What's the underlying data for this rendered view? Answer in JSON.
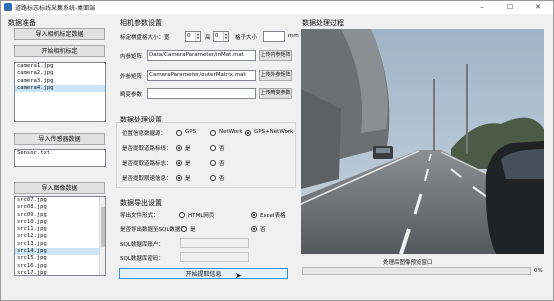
{
  "window": {
    "title": "道路标志标线采集系统-桌面端",
    "min_glyph": "–",
    "max_glyph": "☐",
    "close_glyph": "✕"
  },
  "left": {
    "data_prep_title": "数据准备",
    "import_calib_button": "导入相机标定数据",
    "start_calib_button": "开始相机标定",
    "camera_files": [
      "camera1.jpg",
      "camera2.jpg",
      "camera3.jpg",
      "camera4.jpg"
    ],
    "camera_selected_index": 3,
    "import_sensor_button": "导入传感器数据",
    "sensor_files": [
      "Sensor.txt"
    ],
    "import_image_button": "导入图像数据",
    "image_files": [
      "src07.jpg",
      "src08.jpg",
      "src09.jpg",
      "src10.jpg",
      "src11.jpg",
      "src12.jpg",
      "src13.jpg",
      "src14.jpg",
      "src15.jpg",
      "src16.jpg",
      "src17.jpg",
      "src18.jpg"
    ],
    "image_selected_index": 7
  },
  "camera": {
    "title": "相机参数设置",
    "board_size_label": "标定棋盘格大小：宽",
    "width_value": "0",
    "height_label": "高",
    "height_value": "0",
    "square_label": "格子大小",
    "square_value": "",
    "square_unit": "mm",
    "intrinsic_label": "内参矩阵",
    "intrinsic_value": "Data/CameraParameter/inMat.mat",
    "intrinsic_upload": "上传内参矩阵",
    "extrinsic_label": "外参矩阵",
    "extrinsic_value": "CameraParameter/outerMatrix.mat",
    "extrinsic_upload": "上传外参矩阵",
    "distortion_label": "畸变参数",
    "distortion_value": "",
    "distortion_upload": "上传畸变参数"
  },
  "processing": {
    "title": "数据处理设置",
    "location_source_label": "位置信息数据源：",
    "opt_gps": "GPS",
    "opt_network": "NetWork",
    "opt_gps_network": "GPS+NetWork",
    "location_choice": "gps_network",
    "extract_markings_label": "是否提取道路标线：",
    "extract_signs_label": "是否提取道路标志：",
    "extract_speed_label": "是否提取限速信息：",
    "yes": "是",
    "no": "否"
  },
  "export": {
    "title": "数据导出设置",
    "format_label": "导出文件形式：",
    "opt_html": "HTML网页",
    "opt_excel": "Excel表格",
    "format_choice": "excel",
    "sql_label": "是否导出数据至SQL数据库",
    "sql_yes": "是",
    "sql_no": "否",
    "sql_choice": "no",
    "sql_account_label": "SQL数据库账户：",
    "sql_password_label": "SQL数据库密码：",
    "start_button": "开始提取信息"
  },
  "preview": {
    "title": "数据处理过程",
    "caption": "处理后图像预览窗口",
    "progress_value": 0,
    "progress_text": "0%"
  },
  "colors": {
    "accent": "#cce4f7",
    "button": "#e1e1e1",
    "window_bg": "#f0f0f0"
  }
}
